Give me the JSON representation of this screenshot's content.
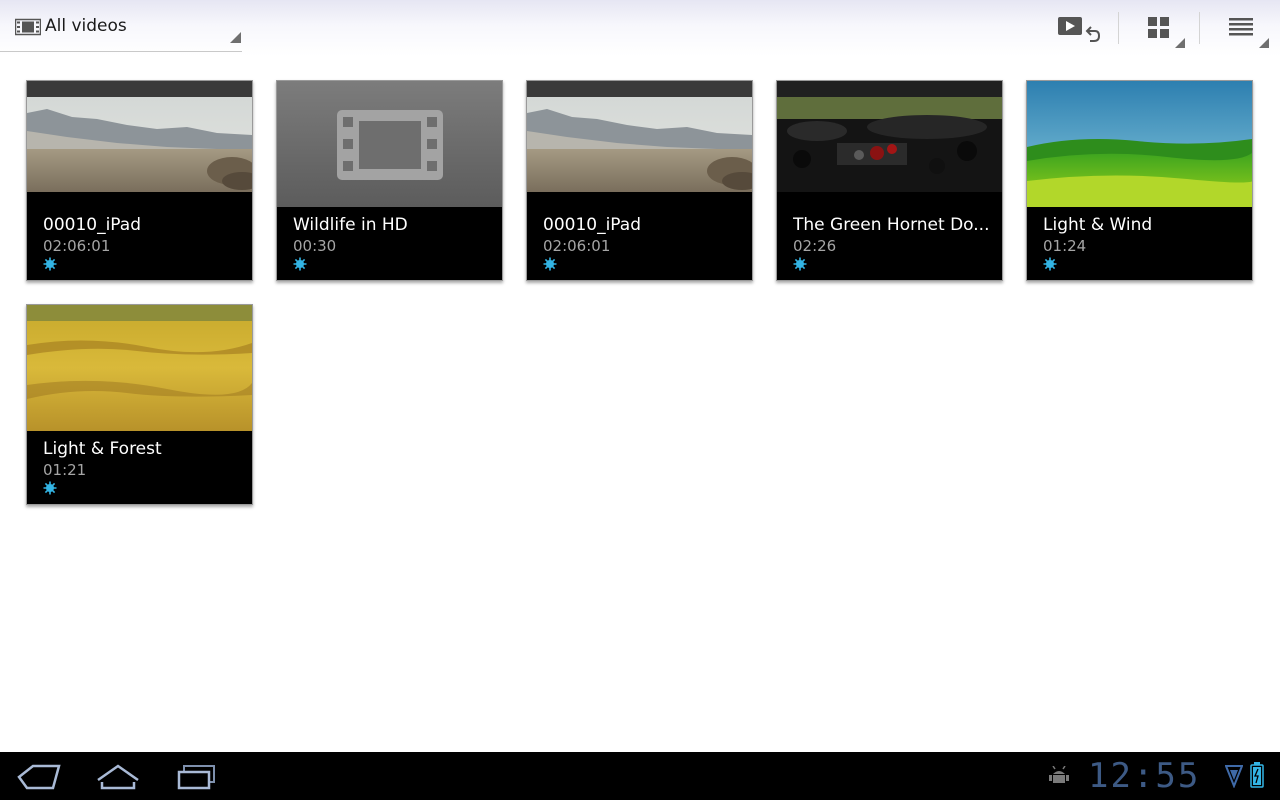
{
  "action_bar": {
    "spinner_label": "All videos",
    "icons": {
      "filter": "film-strip-icon",
      "resume": "play-resume-icon",
      "grid_view": "grid-view-icon",
      "list_view": "list-view-icon"
    }
  },
  "videos": [
    {
      "title": "00010_iPad",
      "duration": "02:06:01",
      "thumbnail": "mountain-desert"
    },
    {
      "title": "Wildlife in HD",
      "duration": "00:30",
      "thumbnail": "film-placeholder"
    },
    {
      "title": "00010_iPad",
      "duration": "02:06:01",
      "thumbnail": "mountain-desert"
    },
    {
      "title": "The Green Hornet Do...",
      "duration": "02:26",
      "thumbnail": "crowd-scene"
    },
    {
      "title": "Light & Wind",
      "duration": "01:24",
      "thumbnail": "green-hills"
    },
    {
      "title": "Light & Forest",
      "duration": "01:21",
      "thumbnail": "golden-grass"
    }
  ],
  "badge_icon": "new-video-star-icon",
  "system_bar": {
    "clock": "12:55",
    "icons": {
      "back": "back-icon",
      "home": "home-icon",
      "recents": "recent-apps-icon",
      "debug": "android-debug-icon",
      "signal": "signal-icon",
      "battery": "battery-icon"
    }
  },
  "colors": {
    "accent": "#33b5e5",
    "card_background": "#000000",
    "duration_text": "#a5a5a5",
    "clock": "#3d5a85"
  }
}
